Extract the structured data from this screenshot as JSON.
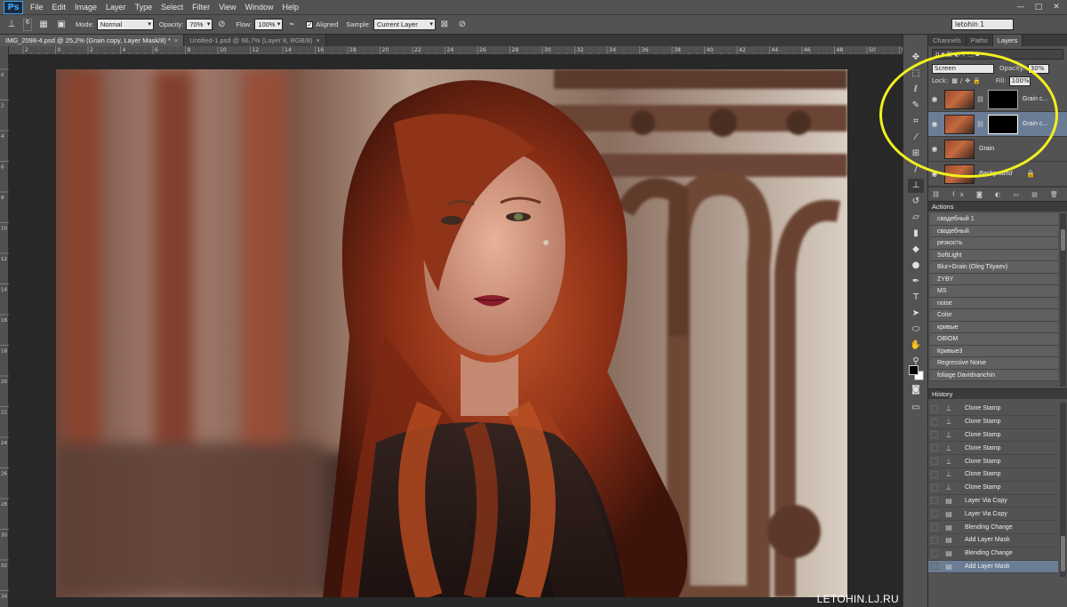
{
  "menu": {
    "app_logo": "Ps",
    "items": [
      "File",
      "Edit",
      "Image",
      "Layer",
      "Type",
      "Select",
      "Filter",
      "View",
      "Window",
      "Help"
    ]
  },
  "window_controls": {
    "minimize": "—",
    "maximize": "□",
    "close": "✕"
  },
  "options_bar": {
    "brush_size": "6",
    "mode_label": "Mode:",
    "mode_value": "Normal",
    "opacity_label": "Opacity:",
    "opacity_value": "70%",
    "flow_label": "Flow:",
    "flow_value": "100%",
    "aligned_label": "Aligned",
    "sample_label": "Sample:",
    "sample_value": "Current Layer",
    "workspace": "letohin 1"
  },
  "doc_tabs": [
    {
      "title": "IMG_2098-4.psd @ 25,2% (Grain copy, Layer Mask/8) *",
      "active": true
    },
    {
      "title": "Untitled-1.psd @ 66,7% (Layer 8, RGB/8)",
      "active": false
    }
  ],
  "ruler_h_labels": [
    "2",
    "0",
    "2",
    "4",
    "6",
    "8",
    "10",
    "12",
    "14",
    "16",
    "18",
    "20",
    "22",
    "24",
    "26",
    "28",
    "30",
    "32",
    "34",
    "36",
    "38",
    "40",
    "42",
    "44",
    "46",
    "48",
    "50",
    "52"
  ],
  "ruler_v_labels": [
    "0",
    "2",
    "4",
    "6",
    "8",
    "10",
    "12",
    "14",
    "16",
    "18",
    "20",
    "22",
    "24",
    "26",
    "28",
    "30",
    "32",
    "34"
  ],
  "watermark": "LETOHIN.LJ.RU",
  "layers_panel": {
    "tabs": [
      "Channels",
      "Paths",
      "Layers"
    ],
    "active_tab": "Layers",
    "blend_mode": "Screen",
    "opacity_label": "Opacity:",
    "opacity_value": "30%",
    "lock_label": "Lock:",
    "fill_label": "Fill:",
    "fill_value": "100%",
    "layers": [
      {
        "name": "Grain c...",
        "has_mask": true,
        "selected": false,
        "italic": false
      },
      {
        "name": "Grain c...",
        "has_mask": true,
        "selected": true,
        "italic": false
      },
      {
        "name": "Grain",
        "has_mask": false,
        "selected": false,
        "italic": false
      },
      {
        "name": "Background",
        "has_mask": false,
        "selected": false,
        "italic": true,
        "locked": true
      }
    ]
  },
  "actions_panel": {
    "title": "Actions",
    "items": [
      "свадебный 1",
      "свадебный",
      "резкость",
      "SoftLight",
      "Blur+Grain (Oleg Tityaev)",
      "ZYBY",
      "MS",
      "noise",
      "Color",
      "кривые",
      "OBIOM",
      "Кривые3",
      "Regressive Noise",
      "foliage Davidnanchin"
    ]
  },
  "history_panel": {
    "title": "History",
    "items": [
      {
        "label": "Clone Stamp",
        "icon": "stamp-icon"
      },
      {
        "label": "Clone Stamp",
        "icon": "stamp-icon"
      },
      {
        "label": "Clone Stamp",
        "icon": "stamp-icon"
      },
      {
        "label": "Clone Stamp",
        "icon": "stamp-icon"
      },
      {
        "label": "Clone Stamp",
        "icon": "stamp-icon"
      },
      {
        "label": "Clone Stamp",
        "icon": "stamp-icon"
      },
      {
        "label": "Clone Stamp",
        "icon": "stamp-icon"
      },
      {
        "label": "Layer Via Copy",
        "icon": "document-icon"
      },
      {
        "label": "Layer Via Copy",
        "icon": "document-icon"
      },
      {
        "label": "Blending Change",
        "icon": "document-icon"
      },
      {
        "label": "Add Layer Mask",
        "icon": "document-icon"
      },
      {
        "label": "Blending Change",
        "icon": "document-icon"
      },
      {
        "label": "Add Layer Mask",
        "icon": "document-icon",
        "current": true
      }
    ]
  },
  "colors": {
    "accent": "#31a8ff",
    "selection": "#6b7d94",
    "annotation": "#f2f01f"
  }
}
